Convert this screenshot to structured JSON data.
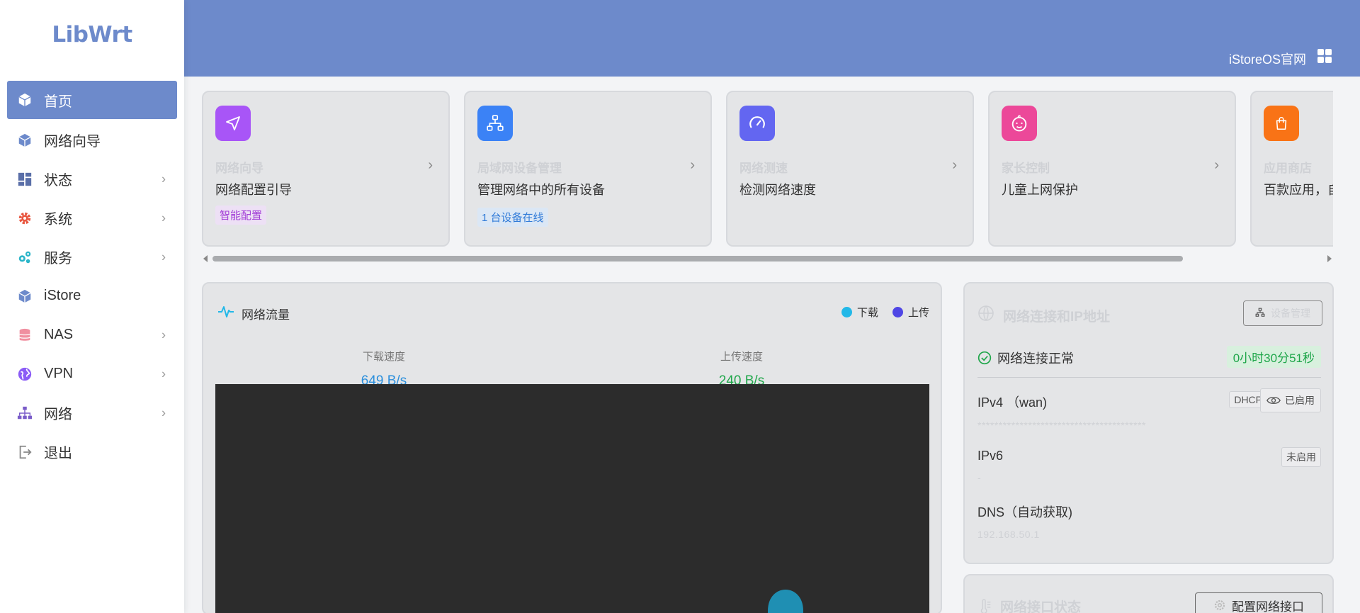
{
  "app": {
    "logo": "LibWrt"
  },
  "sidebar": {
    "items": [
      {
        "label": "首页",
        "icon": "cube-icon",
        "active": true
      },
      {
        "label": "网络向导",
        "icon": "cube-icon"
      },
      {
        "label": "状态",
        "icon": "dashboard-icon",
        "submenu": true
      },
      {
        "label": "系统",
        "icon": "gear-icon",
        "submenu": true
      },
      {
        "label": "服务",
        "icon": "gears-icon",
        "submenu": true
      },
      {
        "label": "iStore",
        "icon": "cube-icon"
      },
      {
        "label": "NAS",
        "icon": "database-icon",
        "submenu": true
      },
      {
        "label": "VPN",
        "icon": "globe-icon",
        "submenu": true
      },
      {
        "label": "网络",
        "icon": "sitemap-icon",
        "submenu": true
      },
      {
        "label": "退出",
        "icon": "logout-icon"
      }
    ]
  },
  "header": {
    "link_label": "iStoreOS官网"
  },
  "cards": [
    {
      "title": "网络向导",
      "desc": "网络配置引导",
      "tag": "智能配置",
      "icon": "navigation-icon",
      "color": "#a855f7"
    },
    {
      "title": "局域网设备管理",
      "desc": "管理网络中的所有设备",
      "tag": "1 台设备在线",
      "icon": "network-icon",
      "color": "#3b82f6"
    },
    {
      "title": "网络测速",
      "desc": "检测网络速度",
      "icon": "speedometer-icon",
      "color": "#6366f1"
    },
    {
      "title": "家长控制",
      "desc": "儿童上网保护",
      "icon": "baby-icon",
      "color": "#ec4899"
    },
    {
      "title": "应用商店",
      "desc": "百款应用，自",
      "icon": "shopping-bag-icon",
      "color": "#f97316"
    }
  ],
  "traffic": {
    "title": "网络流量",
    "legend": [
      {
        "label": "下载",
        "color": "#22b8e8"
      },
      {
        "label": "上传",
        "color": "#4f46e5"
      }
    ],
    "download_label": "下载速度",
    "download_value": "649 B/s",
    "upload_label": "上传速度",
    "upload_value": "240 B/s"
  },
  "netstatus": {
    "title": "网络连接和IP地址",
    "manage_button": "设备管理",
    "status_text": "网络连接正常",
    "uptime": "0小时30分51秒",
    "ipv4_label": "IPv4 （wan)",
    "ipv4_proto": "DHCP",
    "ipv4_enabled": "已启用",
    "ipv4_value": "****************************************",
    "ipv6_label": "IPv6",
    "ipv6_status": "未启用",
    "ipv6_value": "-",
    "dns_label": "DNS（自动获取)",
    "dns_value": "192.168.50.1"
  },
  "ifstatus": {
    "title": "网络接口状态",
    "config_button": "配置网络接口"
  }
}
